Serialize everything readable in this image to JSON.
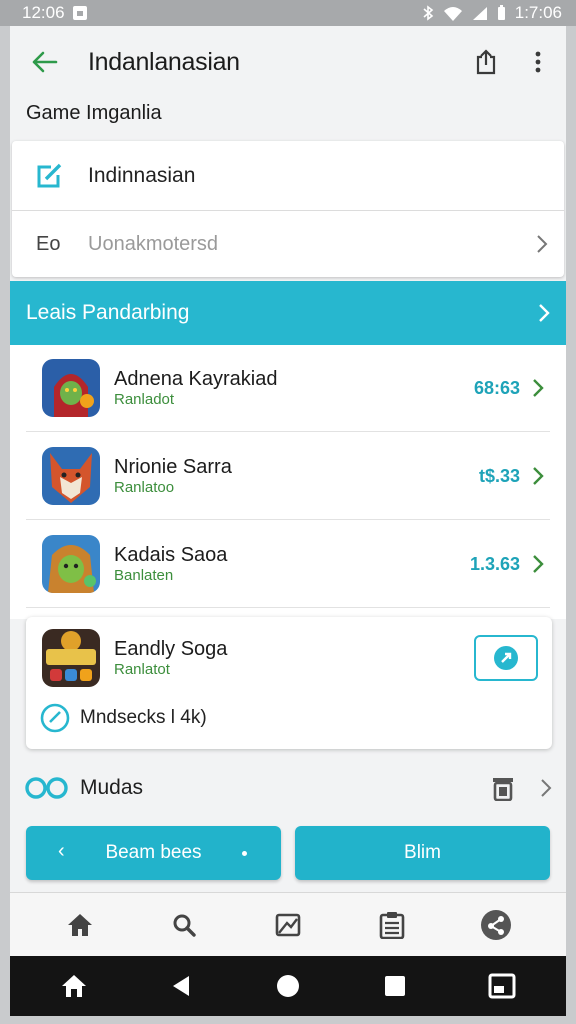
{
  "status_bar": {
    "time_left": "12:06",
    "time_right": "1:7:06"
  },
  "header": {
    "title": "Indanlanasian",
    "icons": [
      "arrow-left-icon",
      "share-icon",
      "more-vert-icon"
    ]
  },
  "subtitle": "Game Imganlia",
  "profile": {
    "label": "Indinnasian",
    "icon": "edit-icon"
  },
  "prefix_row": {
    "prefix": "Eo",
    "value": "Uonakmotersd"
  },
  "banner": {
    "label": "Leais Pandarbing"
  },
  "games": [
    {
      "name": "Adnena Kayrakiad",
      "status": "Ranladot",
      "price": "68:63"
    },
    {
      "name": "Nrionie Sarra",
      "status": "Ranlatoo",
      "price": "t$.33"
    },
    {
      "name": "Kadais Saoa",
      "status": "Banlaten",
      "price": "1.3.63"
    }
  ],
  "featured": {
    "name": "Eandly Soga",
    "status": "Ranlatot",
    "sub_label": "Mndsecks l 4k)"
  },
  "mods": {
    "label": "Mudas"
  },
  "buttons": {
    "left_label": "Beam bees",
    "right_label": "Blim"
  },
  "bottom_nav": [
    "home-icon",
    "search-icon",
    "image-icon",
    "clipboard-icon",
    "share-network-icon"
  ],
  "colors": {
    "accent": "#27b7cf",
    "status_green": "#3c8e3c",
    "back_arrow": "#2e9a4a",
    "price": "#1ea3b8"
  }
}
